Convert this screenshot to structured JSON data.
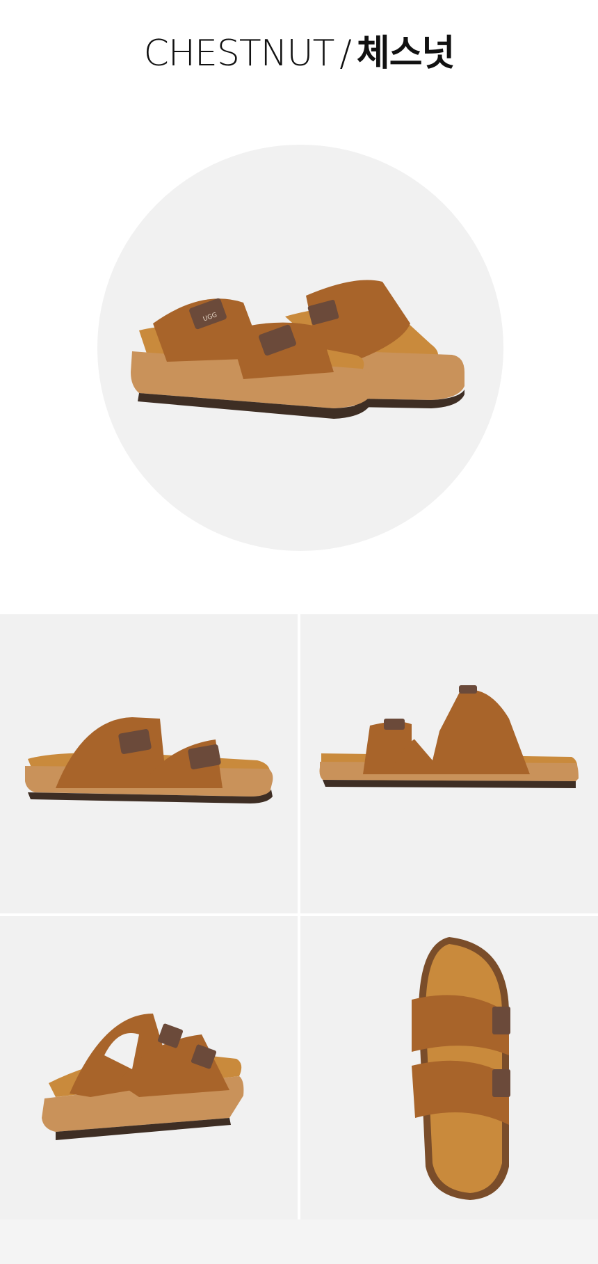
{
  "heading": {
    "color_en": "CHESTNUT",
    "separator": "/",
    "color_ko": "체스넛"
  },
  "brand_mark": "UGG",
  "colors": {
    "suede": "#a8642a",
    "suede_dark": "#8a4e1e",
    "footbed": "#c98a3c",
    "cork": "#c9925a",
    "sole": "#3e2e24",
    "buckle": "#6b4a3a",
    "background": "#f1f1f1"
  },
  "views": [
    {
      "name": "front-angled"
    },
    {
      "name": "side"
    },
    {
      "name": "rear-angled"
    },
    {
      "name": "top"
    }
  ]
}
